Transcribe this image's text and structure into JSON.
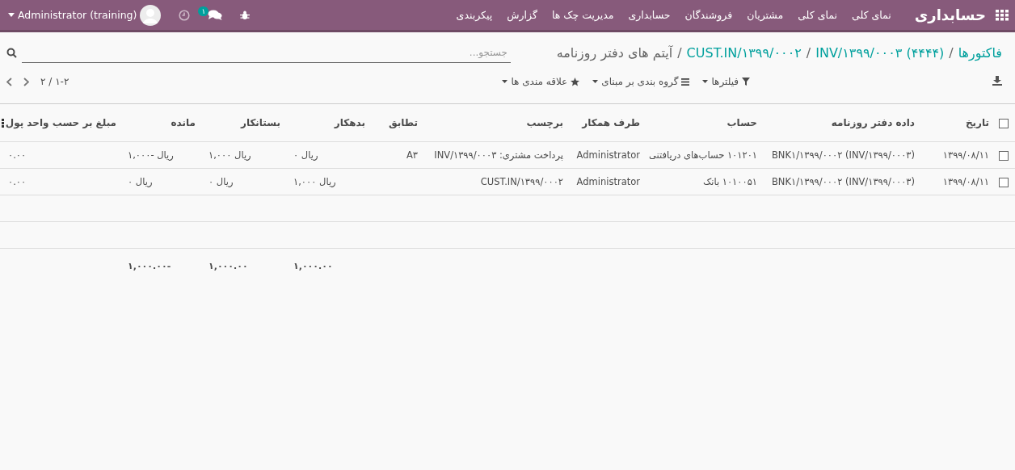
{
  "navbar": {
    "brand": "حسابداری",
    "menu": [
      "نمای کلی",
      "نمای کلی",
      "مشتریان",
      "فروشندگان",
      "حسابداری",
      "مدیریت چک ها",
      "گزارش",
      "پیکربندی"
    ],
    "chat_badge": "۱",
    "user": "Administrator (training)"
  },
  "breadcrumbs": [
    {
      "kind": "link",
      "label": "فاکتورها"
    },
    {
      "kind": "separator",
      "label": "/"
    },
    {
      "kind": "link",
      "label": "(۴۴۴۴) INV/۱۳۹۹/۰۰۰۳"
    },
    {
      "kind": "separator",
      "label": "/"
    },
    {
      "kind": "link",
      "label": "CUST.IN/۱۳۹۹/۰۰۰۲"
    },
    {
      "kind": "separator",
      "label": "/"
    },
    {
      "kind": "current",
      "label": "آیتم های دفتر روزنامه"
    }
  ],
  "search": {
    "placeholder": "جستجو..."
  },
  "toolbar": {
    "filters": "فیلترها",
    "group_by": "گروه بندی بر مبنای",
    "favorites": "علاقه مندی ها",
    "pager": "۱-۲ / ۲"
  },
  "table": {
    "columns": [
      "تاریخ",
      "داده دفتر روزنامه",
      "حساب",
      "طرف همکار",
      "برچسب",
      "تطابق",
      "بدهکار",
      "بستانکار",
      "مانده",
      "مبلغ بر حسب واحد پول"
    ],
    "header_checked": false,
    "rows": [
      {
        "checked": false,
        "cells": [
          "۱۳۹۹/۰۸/۱۱",
          "BNK۱/۱۳۹۹/۰۰۰۲ (INV/۱۳۹۹/۰۰۰۳)",
          "۱۰۱۲۰۱ حساب‌های دریافتنی",
          "Administrator",
          "پرداخت مشتری: INV/۱۳۹۹/۰۰۰۳",
          "A۳",
          "ریال ۰",
          "ریال ۱,۰۰۰",
          "ریال -۱,۰۰۰",
          "۰.۰۰"
        ]
      },
      {
        "checked": false,
        "cells": [
          "۱۳۹۹/۰۸/۱۱",
          "BNK۱/۱۳۹۹/۰۰۰۲ (INV/۱۳۹۹/۰۰۰۳)",
          "۱۰۱۰۰۵۱ بانک",
          "Administrator",
          "CUST.IN/۱۳۹۹/۰۰۰۲",
          "",
          "ریال ۱,۰۰۰",
          "ریال ۰",
          "ریال ۰",
          "۰.۰۰"
        ]
      }
    ],
    "totals": {
      "debit": "۱,۰۰۰.۰۰",
      "credit": "۱,۰۰۰.۰۰",
      "balance": "-۱,۰۰۰.۰۰"
    }
  }
}
